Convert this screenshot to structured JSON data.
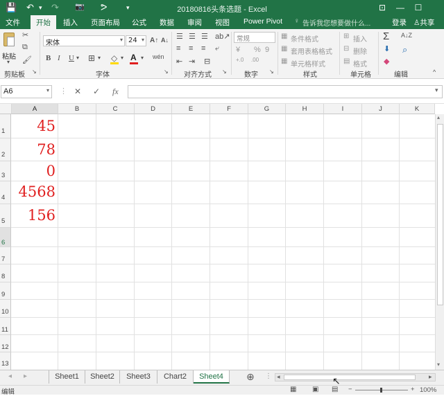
{
  "app": {
    "title": "20180816头条选题 - Excel",
    "qa_save": "💾",
    "qa_undo": "↶",
    "qa_redo": "↷",
    "qa_camera": "📷",
    "qa_custom": "ᕗ",
    "qa_more": "▾",
    "win_options": "⊡",
    "win_min": "—",
    "win_max": "☐"
  },
  "tabs": {
    "file": "文件",
    "home": "开始",
    "insert": "插入",
    "layout": "页面布局",
    "formulas": "公式",
    "data": "数据",
    "review": "审阅",
    "view": "视图",
    "powerpivot": "Power Pivot",
    "tell": "告诉我您想要做什么...",
    "login": "登录",
    "share": "共享"
  },
  "ribbon": {
    "clipboard": {
      "label": "剪贴板",
      "paste": "粘贴"
    },
    "font": {
      "label": "字体",
      "name": "宋体",
      "size": "24",
      "grow": "A↑",
      "shrink": "A↓",
      "bold": "B",
      "italic": "I",
      "underline": "U",
      "border": "⊞",
      "fill": "◇",
      "color": "A",
      "phonetic": "wén"
    },
    "alignment": {
      "label": "对齐方式"
    },
    "number": {
      "label": "数字",
      "format": "常规",
      "currency": "¥",
      "percent": "%",
      "comma": "9",
      "inc_dec": "+.0",
      "dec_dec": ".00"
    },
    "styles": {
      "label": "样式",
      "conditional": "条件格式",
      "table": "套用表格格式",
      "cell": "单元格样式"
    },
    "cells": {
      "label": "单元格",
      "insert": "插入",
      "delete": "删除",
      "format": "格式"
    },
    "editing": {
      "label": "编辑",
      "sum": "Σ",
      "sort": "A↓Z",
      "find": "⌕",
      "fill": "⬇",
      "clear": "◆"
    }
  },
  "formula_bar": {
    "name_box": "A6",
    "cancel": "✕",
    "enter": "✓",
    "fx": "fx",
    "value": ""
  },
  "grid": {
    "columns": [
      "A",
      "B",
      "C",
      "D",
      "E",
      "F",
      "G",
      "H",
      "I",
      "J",
      "K"
    ],
    "rows": [
      "1",
      "2",
      "3",
      "4",
      "5",
      "6",
      "7",
      "8",
      "9",
      "10",
      "11",
      "12",
      "13"
    ],
    "cells": {
      "A1": "45",
      "A2": "78",
      "A3": "0",
      "A4": "4568",
      "A5": "156"
    }
  },
  "sheets": {
    "nav_prev": "◂",
    "nav_next": "▸",
    "tabs": [
      "Sheet1",
      "Sheet2",
      "Sheet3",
      "Chart2",
      "Sheet4"
    ],
    "active": "Sheet4",
    "add": "⊕"
  },
  "status": {
    "mode": "编辑",
    "zoom_out": "−",
    "zoom_in": "+",
    "zoom": "100%"
  },
  "colors": {
    "accent": "#217346",
    "cell_text": "#e02020"
  }
}
